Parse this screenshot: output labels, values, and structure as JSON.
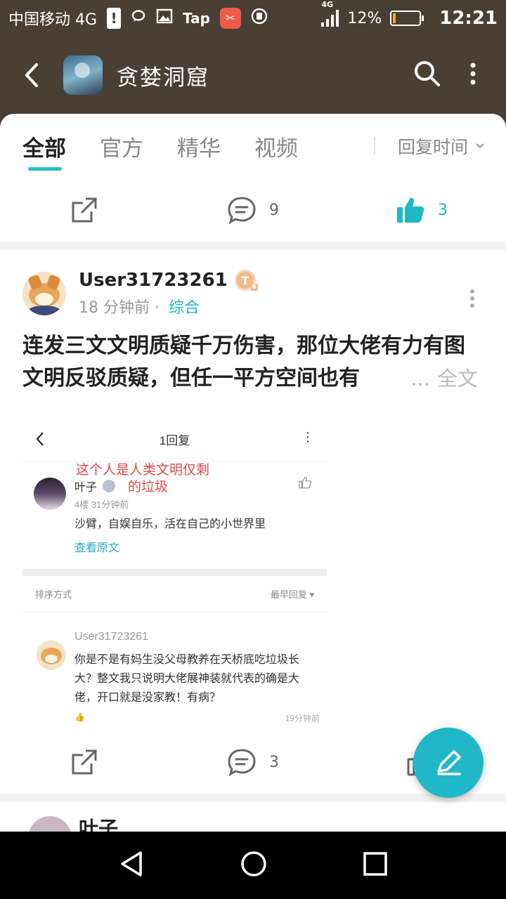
{
  "status_bar": {
    "carrier": "中国移动 4G",
    "tap_label": "Tap",
    "network": "4G",
    "battery": "12%",
    "battery_level": 0.12,
    "time": "12:21"
  },
  "header": {
    "title": "贪婪洞窟"
  },
  "tabs": [
    "全部",
    "官方",
    "精华",
    "视频"
  ],
  "sort_label": "回复时间",
  "prev_post": {
    "comments": "9",
    "likes": "3"
  },
  "post": {
    "username": "User31723261",
    "badge": "T",
    "badge_level": "6",
    "time": "18 分钟前",
    "separator": "·",
    "category": "综合",
    "title": "连发三文文明质疑千万伤害，那位大佬有力有图文明反驳质疑，但任一平方空间也有",
    "ellipsis": "...",
    "full_text_label": "全文",
    "comments": "3"
  },
  "embedded": {
    "header_title": "1回复",
    "red_note_line1": "这个人是人类文明仅剩",
    "red_note_line2": "的垃圾",
    "comment1_name": "叶子",
    "comment1_meta": "4楼   31分钟前",
    "comment1_text": "沙臂，自娱自乐，活在自己的小世界里",
    "view_original": "查看原文",
    "sort_label": "排序方式",
    "sort_value": "最早回复",
    "comment2_name": "User31723261",
    "comment2_text": "你是不是有妈生没父母教养在天桥底吃垃圾长大？整文我只说明大佬展神装就代表的确是大佬，开口就是没家教！有病？",
    "comment2_time": "19分钟前"
  },
  "next_post": {
    "username": "叶子"
  },
  "colors": {
    "accent": "#20b8c8",
    "header_bg": "#4a3f35",
    "red_note": "#e04a4a"
  },
  "icons": [
    "back-arrow-icon",
    "search-icon",
    "more-vertical-icon",
    "share-icon",
    "comment-icon",
    "thumbs-up-icon",
    "edit-pen-icon",
    "nav-back-icon",
    "nav-home-icon",
    "nav-recents-icon"
  ]
}
